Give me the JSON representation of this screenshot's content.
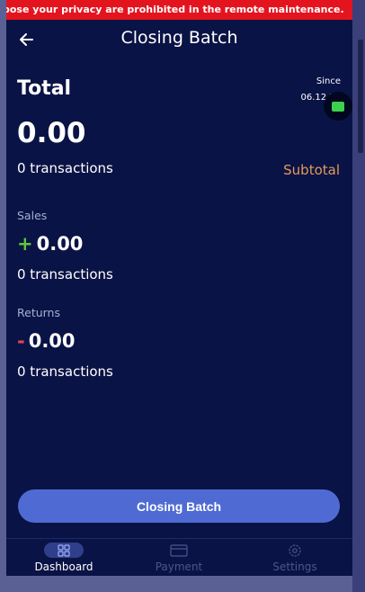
{
  "banner": {
    "text": "pose your privacy are prohibited in the remote maintenance."
  },
  "header": {
    "title": "Closing Batch",
    "back_icon": "arrow-left-icon"
  },
  "summary": {
    "total_label": "Total",
    "since_label": "Since",
    "since_date": "06.12.20",
    "total_amount": "0.00",
    "total_transactions": "0 transactions",
    "subtotal_label": "Subtotal"
  },
  "sales": {
    "label": "Sales",
    "sign": "+",
    "amount": "0.00",
    "transactions": "0 transactions"
  },
  "returns": {
    "label": "Returns",
    "sign": "-",
    "amount": "0.00",
    "transactions": "0 transactions"
  },
  "actions": {
    "closing_batch_label": "Closing Batch"
  },
  "nav": {
    "items": [
      {
        "label": "Dashboard",
        "icon": "grid-icon",
        "active": true
      },
      {
        "label": "Payment",
        "icon": "card-icon",
        "active": false
      },
      {
        "label": "Settings",
        "icon": "gear-icon",
        "active": false
      }
    ]
  },
  "colors": {
    "background": "#0a1345",
    "banner": "#e4141f",
    "accent_button": "#4f6bd3",
    "subtotal": "#e39a5c",
    "plus": "#5cc83a",
    "minus": "#e44454"
  }
}
